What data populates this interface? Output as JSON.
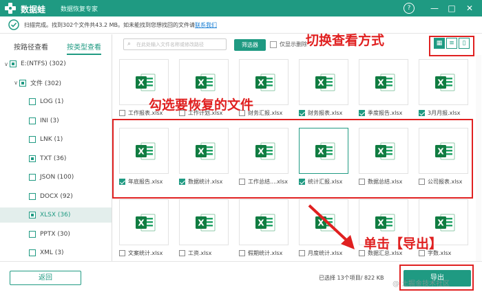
{
  "app": {
    "name": "数据蛙",
    "subtitle": "数据恢复专家",
    "help_icon": "question-icon",
    "min_icon": "minimize-icon",
    "max_icon": "maximize-icon",
    "close_icon": "close-icon",
    "brand_color": "#1f9a82"
  },
  "notice": {
    "text": "扫描完成。找到302个文件共43.2 MB。如未能找到您想找回的文件请",
    "link": "联系我们",
    "icon": "check-circle-icon"
  },
  "sidebar": {
    "tabs": [
      "按路径查看",
      "按类型查看"
    ],
    "active_tab": "按类型查看",
    "tree": [
      {
        "label": "E:(NTFS) (302)",
        "level": 0,
        "state": "partial",
        "expanded": true
      },
      {
        "label": "文件 (302)",
        "level": 1,
        "state": "partial",
        "expanded": true
      },
      {
        "label": "LOG (1)",
        "level": 2,
        "state": "unchecked"
      },
      {
        "label": "INI (3)",
        "level": 2,
        "state": "unchecked"
      },
      {
        "label": "LNK (1)",
        "level": 2,
        "state": "unchecked"
      },
      {
        "label": "TXT (36)",
        "level": 2,
        "state": "partial"
      },
      {
        "label": "JSON (100)",
        "level": 2,
        "state": "unchecked"
      },
      {
        "label": "DOCX (92)",
        "level": 2,
        "state": "unchecked"
      },
      {
        "label": "XLSX (36)",
        "level": 2,
        "state": "partial",
        "selected": true
      },
      {
        "label": "PPTX (30)",
        "level": 2,
        "state": "unchecked"
      },
      {
        "label": "XML (3)",
        "level": 2,
        "state": "unchecked"
      }
    ]
  },
  "toolbar": {
    "search_placeholder": "在此处输入文件名称或修改路径",
    "filter_label": "筛选器",
    "deleted_only_label": "仅显示删除",
    "view_modes": [
      "grid",
      "list",
      "detail"
    ],
    "active_view": "grid"
  },
  "files": [
    {
      "name": "工作报表.xlsx",
      "checked": false
    },
    {
      "name": "工作计划.xlsx",
      "checked": false
    },
    {
      "name": "财务汇报.xlsx",
      "checked": false
    },
    {
      "name": "财务报表.xlsx",
      "checked": true
    },
    {
      "name": "季度报告.xlsx",
      "checked": true
    },
    {
      "name": "3月月报.xlsx",
      "checked": true
    },
    {
      "name": "年底报告.xlsx",
      "checked": true
    },
    {
      "name": "数据统计.xlsx",
      "checked": true
    },
    {
      "name": "工作总结....xlsx",
      "checked": false
    },
    {
      "name": "统计汇报.xlsx",
      "checked": true,
      "highlight": true
    },
    {
      "name": "数据总结.xlsx",
      "checked": false
    },
    {
      "name": "公司报表.xlsx",
      "checked": false
    },
    {
      "name": "文案统计.xlsx",
      "checked": false
    },
    {
      "name": "工资.xlsx",
      "checked": false
    },
    {
      "name": "假期统计.xlsx",
      "checked": false
    },
    {
      "name": "月度统计.xlsx",
      "checked": false
    },
    {
      "name": "数据汇总.xlsx",
      "checked": false
    },
    {
      "name": "字数.xlsx",
      "checked": false
    }
  ],
  "footer": {
    "back_label": "返回",
    "selected_text": "已选择 13个项目/ 822 KB",
    "export_label": "导出"
  },
  "annotations": {
    "switch_view": "切换查看方式",
    "select_files": "勾选要恢复的文件",
    "click_export": "单击【导出】"
  },
  "watermark": "@ 土掘金技术社区"
}
